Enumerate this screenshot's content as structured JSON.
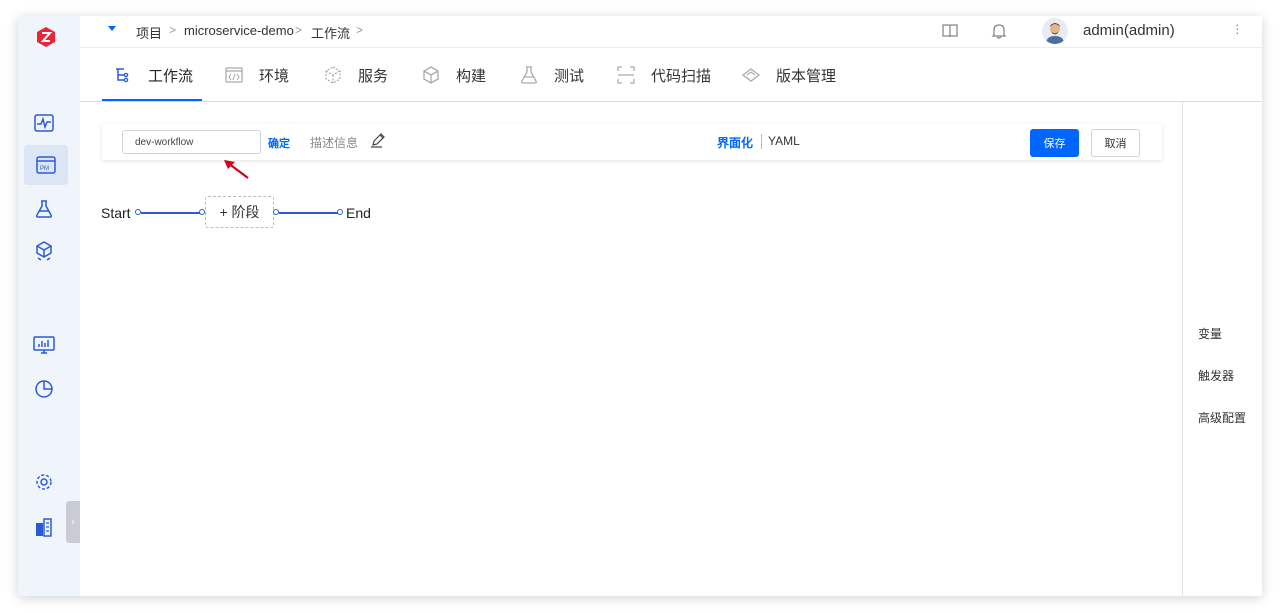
{
  "breadcrumb": {
    "project": "项目",
    "sep1": ">",
    "project_name": "microservice-demo",
    "sep2": ">",
    "section": "工作流",
    "sep3": ">"
  },
  "user": {
    "name": "admin(admin)"
  },
  "tabs": [
    {
      "label": "工作流",
      "icon": "workflow-icon",
      "active": true
    },
    {
      "label": "环境",
      "icon": "environment-icon"
    },
    {
      "label": "服务",
      "icon": "service-icon"
    },
    {
      "label": "构建",
      "icon": "build-icon"
    },
    {
      "label": "测试",
      "icon": "test-flask-icon"
    },
    {
      "label": "代码扫描",
      "icon": "scan-icon"
    },
    {
      "label": "版本管理",
      "icon": "version-icon"
    }
  ],
  "toolbar": {
    "workflow_name": "dev-workflow",
    "confirm_label": "确定",
    "description_label": "描述信息",
    "mode_gui": "界面化",
    "mode_yaml": "YAML",
    "save_label": "保存",
    "cancel_label": "取消"
  },
  "pipeline": {
    "start_label": "Start",
    "add_stage_label": "+ 阶段",
    "end_label": "End"
  },
  "right_panel": {
    "variables": "变量",
    "triggers": "触发器",
    "advanced": "高级配置"
  },
  "colors": {
    "accent": "#0066ff",
    "logo": "#e8263a",
    "sidebar_bg": "#f0f4fb"
  }
}
